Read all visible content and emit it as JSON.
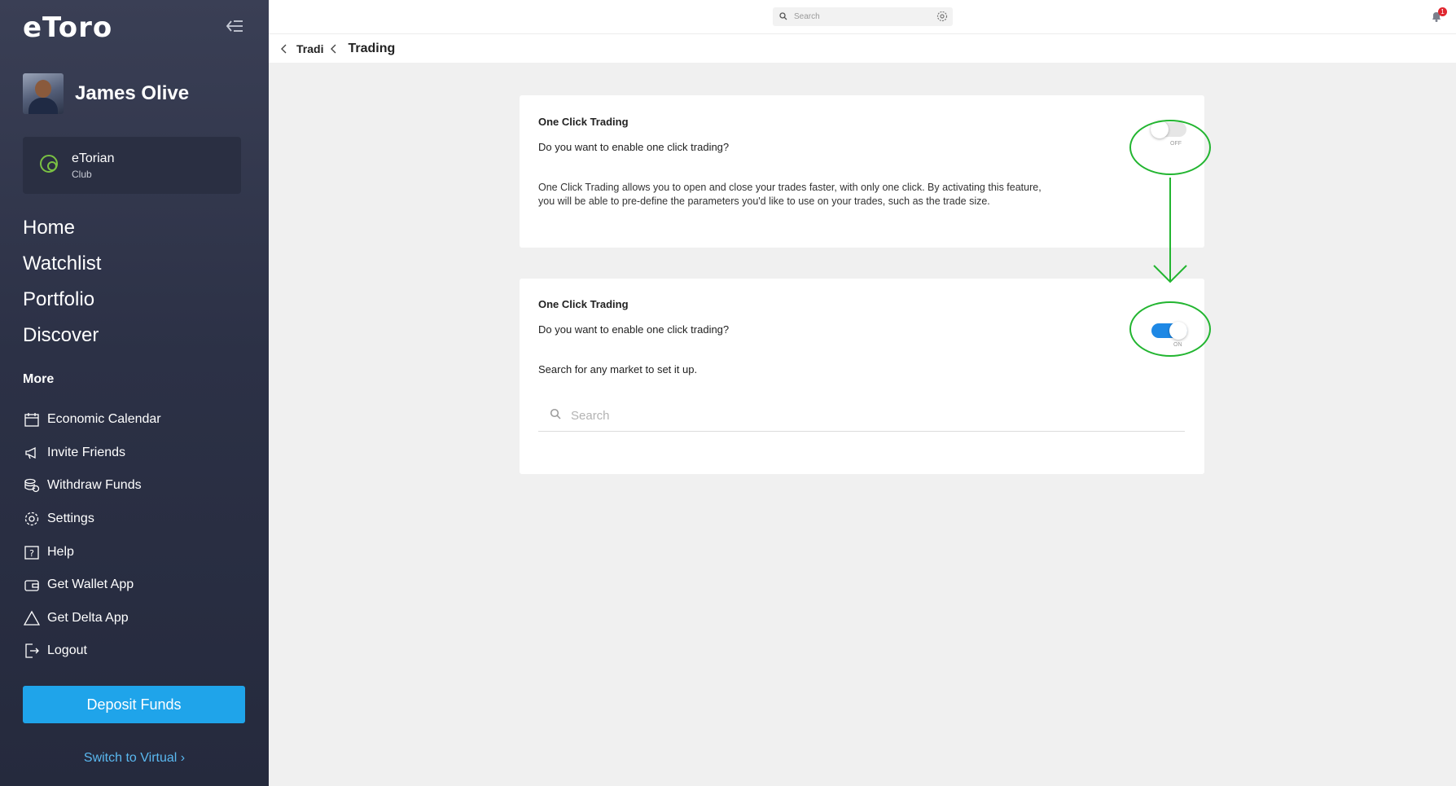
{
  "sidebar": {
    "logo": "eToro",
    "user_name": "James Olive",
    "club": {
      "title": "eTorian",
      "subtitle": "Club"
    },
    "main_nav": [
      "Home",
      "Watchlist",
      "Portfolio",
      "Discover"
    ],
    "more_title": "More",
    "more_items": [
      {
        "label": "Economic Calendar",
        "icon": "calendar-icon"
      },
      {
        "label": "Invite Friends",
        "icon": "megaphone-icon"
      },
      {
        "label": "Withdraw Funds",
        "icon": "coins-icon"
      },
      {
        "label": "Settings",
        "icon": "gear-icon"
      },
      {
        "label": "Help",
        "icon": "help-icon"
      },
      {
        "label": "Get Wallet App",
        "icon": "wallet-icon"
      },
      {
        "label": "Get Delta App",
        "icon": "delta-icon"
      },
      {
        "label": "Logout",
        "icon": "logout-icon"
      }
    ],
    "deposit_label": "Deposit Funds",
    "switch_virtual": "Switch to Virtual ›"
  },
  "topbar": {
    "search_placeholder": "Search",
    "notification_count": "1"
  },
  "breadcrumb": {
    "prev": "Tradi",
    "current": "Trading"
  },
  "card_off": {
    "title": "One Click Trading",
    "question": "Do you want to enable one click trading?",
    "description": "One Click Trading allows you to open and close your trades faster, with only one click. By activating this feature, you will be able to pre-define the parameters you'd like to use on your trades, such as the trade size.",
    "toggle_state": "OFF"
  },
  "card_on": {
    "title": "One Click Trading",
    "question": "Do you want to enable one click trading?",
    "hint": "Search for any market to set it up.",
    "search_placeholder": "Search",
    "toggle_state": "ON"
  },
  "colors": {
    "accent": "#1fa4ea",
    "toggle_on": "#1e88e5",
    "annotation": "#22b530",
    "sidebar_bg": "#2c3146"
  }
}
